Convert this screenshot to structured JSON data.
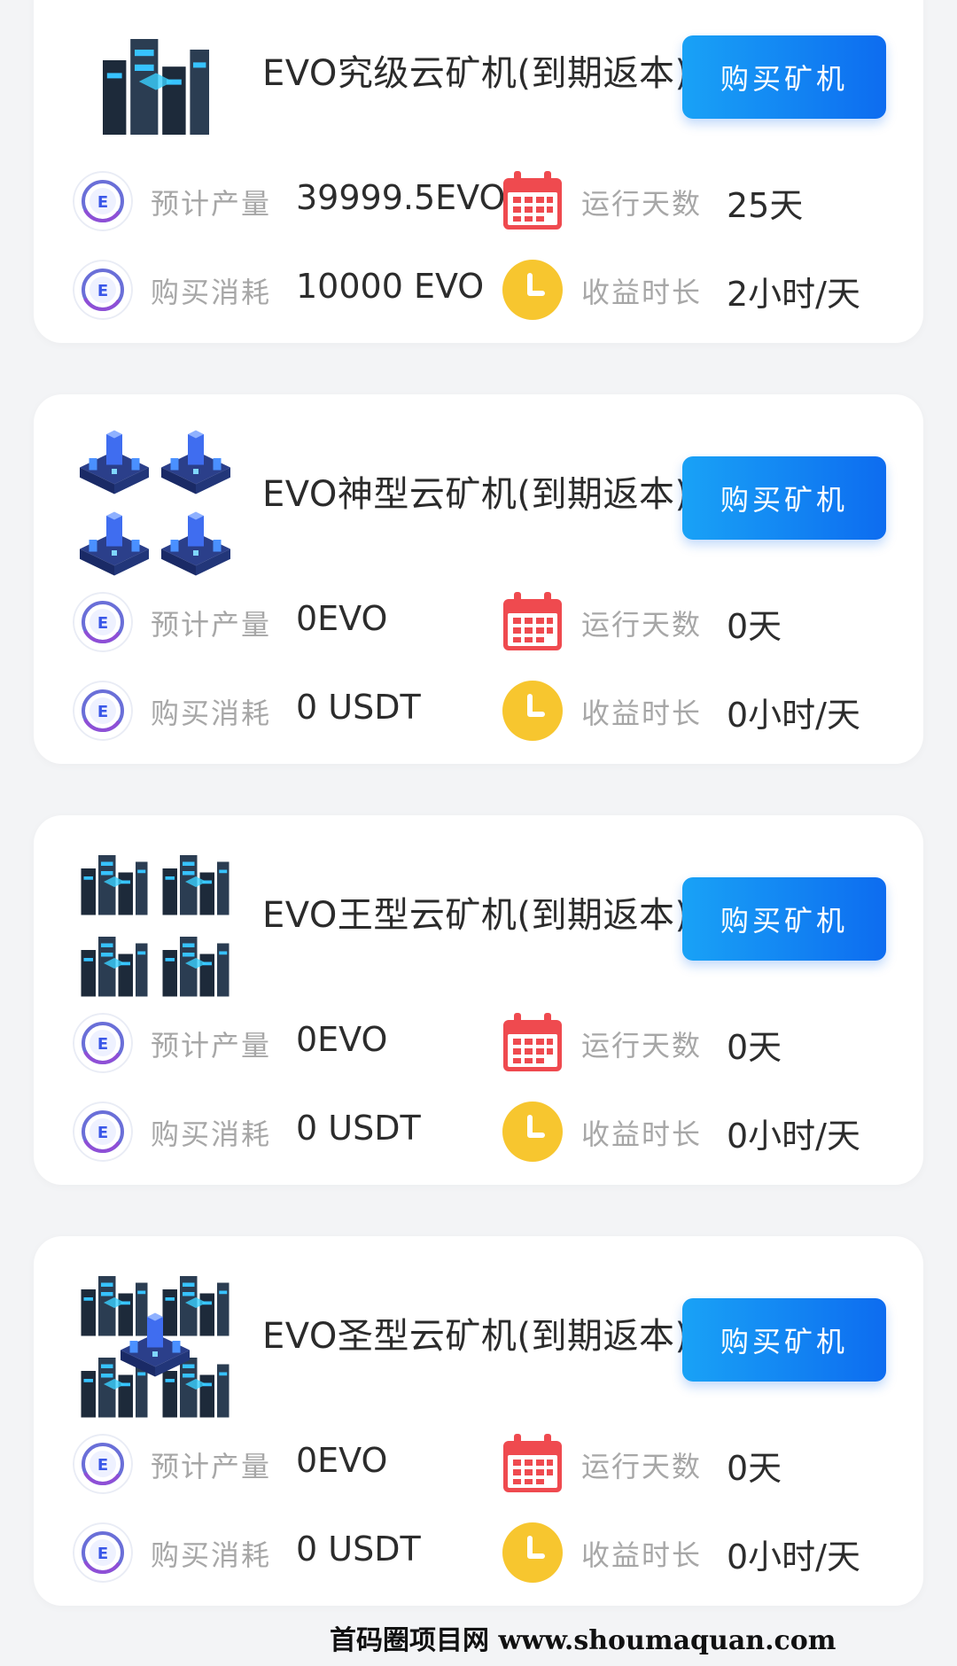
{
  "cards": [
    {
      "title": "EVO究级云矿机(到期返本)",
      "button_label": "购买矿机",
      "output_label": "预计产量",
      "output_value": "39999.5EVO",
      "days_label": "运行天数",
      "days_value": "25天",
      "cost_label": "购买消耗",
      "cost_value": "10000 EVO",
      "duration_label": "收益时长",
      "duration_value": "2小时/天"
    },
    {
      "title": "EVO神型云矿机(到期返本)",
      "button_label": "购买矿机",
      "output_label": "预计产量",
      "output_value": "0EVO",
      "days_label": "运行天数",
      "days_value": "0天",
      "cost_label": "购买消耗",
      "cost_value": "0 USDT",
      "duration_label": "收益时长",
      "duration_value": "0小时/天"
    },
    {
      "title": "EVO王型云矿机(到期返本)",
      "button_label": "购买矿机",
      "output_label": "预计产量",
      "output_value": "0EVO",
      "days_label": "运行天数",
      "days_value": "0天",
      "cost_label": "购买消耗",
      "cost_value": "0 USDT",
      "duration_label": "收益时长",
      "duration_value": "0小时/天"
    },
    {
      "title": "EVO圣型云矿机(到期返本)",
      "button_label": "购买矿机",
      "output_label": "预计产量",
      "output_value": "0EVO",
      "days_label": "运行天数",
      "days_value": "0天",
      "cost_label": "购买消耗",
      "cost_value": "0 USDT",
      "duration_label": "收益时长",
      "duration_value": "0小时/天"
    }
  ],
  "icons": {
    "coin": "evo-coin-icon",
    "calendar": "calendar-icon",
    "clock": "clock-icon"
  },
  "colors": {
    "button_start": "#19a2f6",
    "button_end": "#0d6cf0",
    "calendar_red": "#ef4a4f",
    "clock_yellow": "#f7c62f",
    "label_gray": "#a7a7a7"
  },
  "footer": {
    "watermark": "首码圈项目网 www.shoumaquan.com"
  }
}
